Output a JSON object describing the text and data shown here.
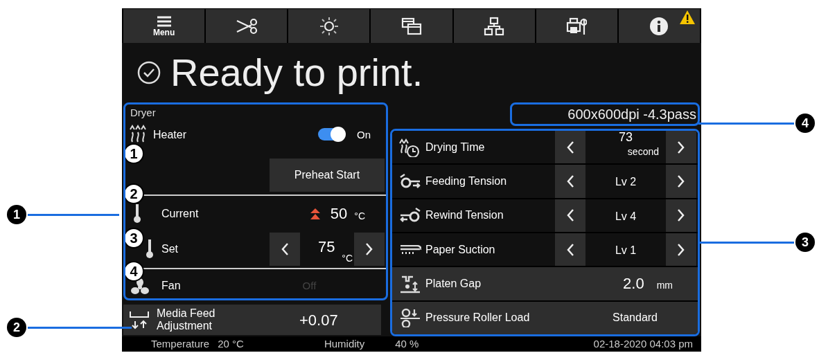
{
  "toolbar": [
    {
      "kind": "menu",
      "label": "Menu"
    },
    {
      "kind": "cutter"
    },
    {
      "kind": "light"
    },
    {
      "kind": "windows"
    },
    {
      "kind": "network"
    },
    {
      "kind": "maintenance"
    },
    {
      "kind": "info",
      "alert": true
    }
  ],
  "status": "Ready to print.",
  "dryer": {
    "title": "Dryer",
    "heater": {
      "label": "Heater",
      "on": true,
      "state_text": "On",
      "marker": "1"
    },
    "preheat_button": "Preheat Start",
    "current": {
      "label": "Current",
      "value": "50",
      "unit": "°C",
      "marker": "2"
    },
    "set": {
      "label": "Set",
      "value": "75",
      "unit": "°C",
      "marker": "3"
    },
    "fan": {
      "label": "Fan",
      "value": "Off",
      "disabled": true,
      "marker": "4"
    }
  },
  "media_feed": {
    "label": "Media Feed Adjustment",
    "value": "+0.07"
  },
  "print_mode": "600x600dpi -4.3pass",
  "settings": [
    {
      "kind": "stepper",
      "label": "Drying Time",
      "value": "73",
      "unit": "second"
    },
    {
      "kind": "stepper",
      "label": "Feeding Tension",
      "value": "Lv 2"
    },
    {
      "kind": "stepper",
      "label": "Rewind Tension",
      "value": "Lv 4"
    },
    {
      "kind": "stepper",
      "label": "Paper Suction",
      "value": "Lv 1"
    },
    {
      "kind": "value",
      "label": "Platen Gap",
      "value": "2.0",
      "unit": "mm"
    },
    {
      "kind": "value",
      "label": "Pressure Roller Load",
      "value": "Standard"
    }
  ],
  "footer": {
    "temperature_label": "Temperature",
    "temperature": "20 °C",
    "humidity_label": "Humidity",
    "humidity": "40 %",
    "datetime": "02-18-2020 04:03 pm"
  },
  "callouts": [
    {
      "number": "1"
    },
    {
      "number": "2"
    },
    {
      "number": "3"
    },
    {
      "number": "4"
    }
  ]
}
